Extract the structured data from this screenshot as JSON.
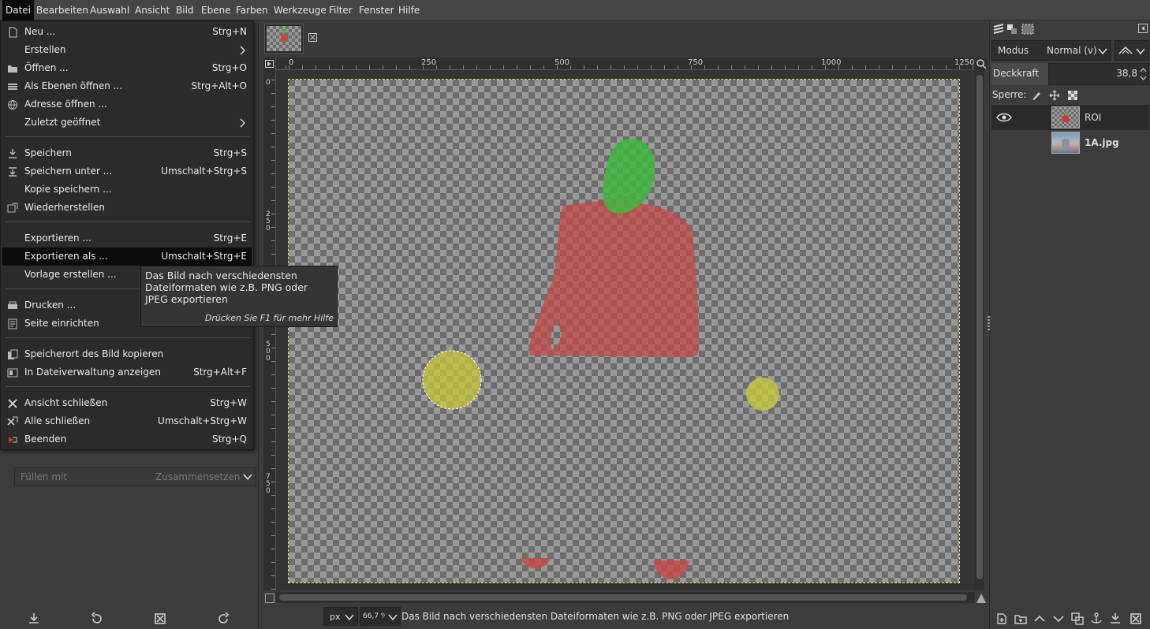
{
  "menubar": {
    "items": [
      "Datei",
      "Bearbeiten",
      "Auswahl",
      "Ansicht",
      "Bild",
      "Ebene",
      "Farben",
      "Werkzeuge",
      "Filter",
      "Fenster",
      "Hilfe"
    ]
  },
  "file_menu": {
    "items": [
      {
        "label": "Neu ...",
        "accel": "Strg+N",
        "icon": "new-document-icon"
      },
      {
        "label": "Erstellen",
        "accel": "",
        "icon": "",
        "submenu": true
      },
      {
        "label": "Öffnen ...",
        "accel": "Strg+O",
        "icon": "open-folder-icon"
      },
      {
        "label": "Als Ebenen öffnen ...",
        "accel": "Strg+Alt+O",
        "icon": "open-as-layers-icon"
      },
      {
        "label": "Adresse öffnen ...",
        "accel": "",
        "icon": "globe-icon"
      },
      {
        "label": "Zuletzt geöffnet",
        "accel": "",
        "icon": "",
        "submenu": true
      },
      {
        "label": "Speichern",
        "accel": "Strg+S",
        "icon": "save-icon"
      },
      {
        "label": "Speichern unter ...",
        "accel": "Umschalt+Strg+S",
        "icon": "save-as-icon"
      },
      {
        "label": "Kopie speichern ...",
        "accel": "",
        "icon": ""
      },
      {
        "label": "Wiederherstellen",
        "accel": "",
        "icon": "revert-icon"
      },
      {
        "label": "Exportieren ...",
        "accel": "Strg+E",
        "icon": ""
      },
      {
        "label": "Exportieren als ...",
        "accel": "Umschalt+Strg+E",
        "icon": "",
        "highlighted": true
      },
      {
        "label": "Vorlage erstellen ...",
        "accel": "",
        "icon": ""
      },
      {
        "label": "Drucken ...",
        "accel": "",
        "icon": "printer-icon"
      },
      {
        "label": "Seite einrichten",
        "accel": "",
        "icon": "page-setup-icon"
      },
      {
        "label": "Speicherort des Bild kopieren",
        "accel": "",
        "icon": "copy-location-icon"
      },
      {
        "label": "In Dateiverwaltung anzeigen",
        "accel": "Strg+Alt+F",
        "icon": "file-manager-icon"
      },
      {
        "label": "Ansicht schließen",
        "accel": "Strg+W",
        "icon": "close-icon"
      },
      {
        "label": "Alle schließen",
        "accel": "Umschalt+Strg+W",
        "icon": "close-all-icon"
      },
      {
        "label": "Beenden",
        "accel": "Strg+Q",
        "icon": "quit-icon"
      }
    ]
  },
  "tooltip": {
    "text": "Das Bild nach verschiedensten Dateiformaten wie z.B. PNG oder JPEG exportieren",
    "help": "Drücken Sie F1 für mehr Hilfe"
  },
  "left_panel": {
    "fill_label": "Füllen mit",
    "fill_value": "Zusammensetzen"
  },
  "hruler": {
    "ticks": [
      "0",
      "250",
      "500",
      "750",
      "1000",
      "1250"
    ]
  },
  "vruler": {
    "ticks": [
      "0",
      "250",
      "500",
      "750"
    ]
  },
  "statusbar": {
    "unit": "px",
    "zoom": "66,7 %",
    "message": "Das Bild nach verschiedensten Dateiformaten wie z.B. PNG oder JPEG exportieren"
  },
  "layers_panel": {
    "mode_label": "Modus",
    "mode_value": "Normal (v)",
    "opacity_label": "Deckkraft",
    "opacity_value": "38,8",
    "lock_label": "Sperre:",
    "layers": [
      {
        "name": "ROI",
        "visible": true,
        "selected": true
      },
      {
        "name": "1A.jpg",
        "visible": false,
        "selected": false
      }
    ]
  },
  "colors": {
    "menu_bg": "#2b2b2b",
    "highlight": "#0b0b0b",
    "roi_red": "#c84646",
    "roi_green": "#3fb83f",
    "roi_yellow": "#c8c83a"
  }
}
